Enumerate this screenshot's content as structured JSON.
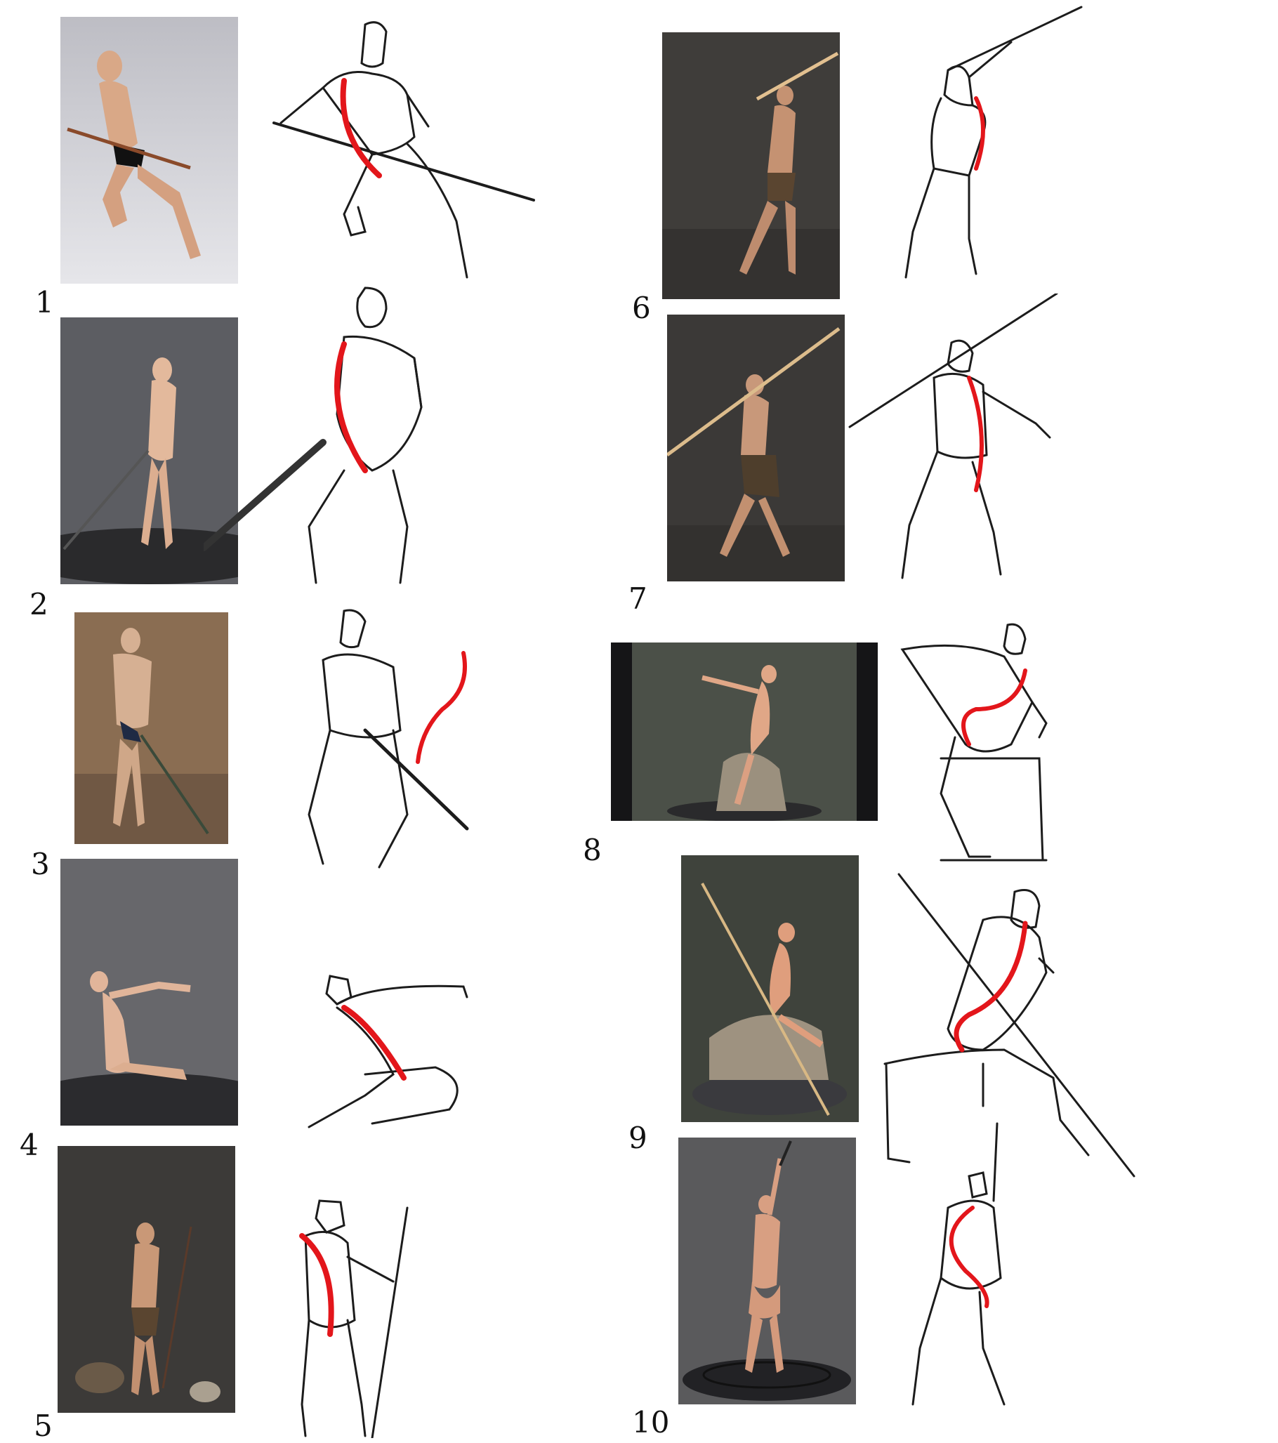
{
  "page": {
    "title": ""
  },
  "poses": [
    {
      "number": "1",
      "photo_bg": "#cfcfd4",
      "figure_tone": "#d9a887",
      "prop": "staff",
      "accent": "#e3161b"
    },
    {
      "number": "2",
      "photo_bg": "#5c5d62",
      "figure_tone": "#e3b99c",
      "prop": "sword",
      "accent": "#e3161b"
    },
    {
      "number": "3",
      "photo_bg": "#8a6d52",
      "figure_tone": "#d6b093",
      "prop": "sword",
      "accent": "#e3161b"
    },
    {
      "number": "4",
      "photo_bg": "#67676b",
      "figure_tone": "#e1b59a",
      "prop": "none",
      "accent": "#e3161b"
    },
    {
      "number": "5",
      "photo_bg": "#3c3a38",
      "figure_tone": "#c99877",
      "prop": "spear",
      "accent": "#e3161b"
    },
    {
      "number": "6",
      "photo_bg": "#3f3d3a",
      "figure_tone": "#c59272",
      "prop": "staff",
      "accent": "#e3161b"
    },
    {
      "number": "7",
      "photo_bg": "#3b3937",
      "figure_tone": "#c8987a",
      "prop": "staff",
      "accent": "#e3161b"
    },
    {
      "number": "8",
      "photo_bg": "#4b5048",
      "figure_tone": "#e0a787",
      "prop": "none",
      "accent": "#e3161b"
    },
    {
      "number": "9",
      "photo_bg": "#3f433c",
      "figure_tone": "#df9e7d",
      "prop": "staff",
      "accent": "#e3161b"
    },
    {
      "number": "10",
      "photo_bg": "#5a5a5c",
      "figure_tone": "#d89f82",
      "prop": "sword",
      "accent": "#e3161b"
    }
  ]
}
